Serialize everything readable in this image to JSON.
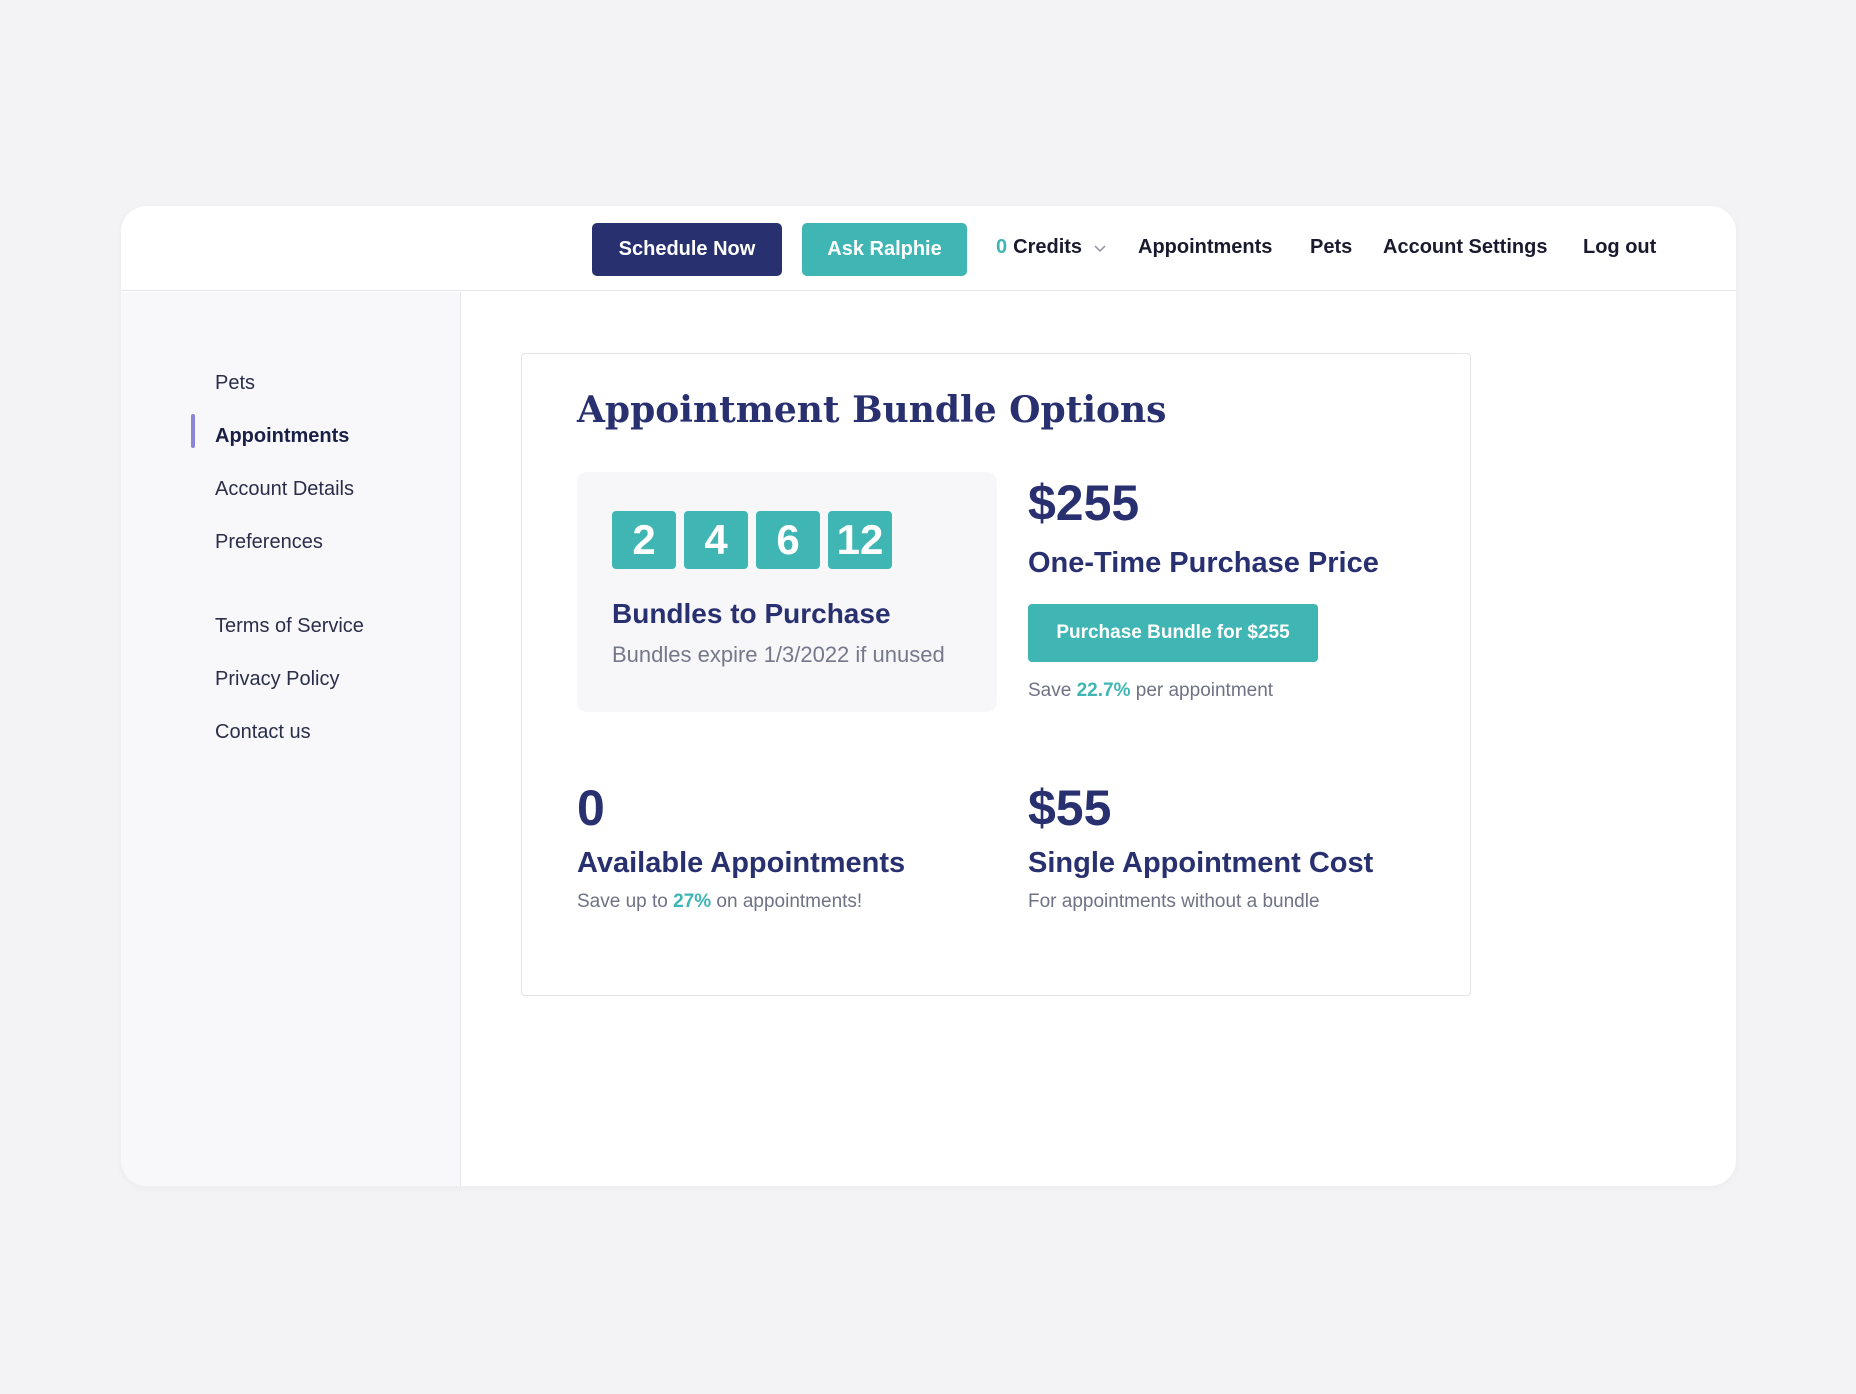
{
  "topbar": {
    "schedule_button": "Schedule Now",
    "ask_button": "Ask Ralphie",
    "credits_count": "0",
    "credits_label": "Credits",
    "nav": [
      "Appointments",
      "Pets",
      "Account Settings",
      "Log out"
    ]
  },
  "sidebar": {
    "items": [
      "Pets",
      "Appointments",
      "Account Details",
      "Preferences"
    ],
    "active_item": "Appointments",
    "footer_items": [
      "Terms of Service",
      "Privacy Policy",
      "Contact us"
    ]
  },
  "card": {
    "title": "Appointment Bundle Options",
    "bundle_options": [
      "2",
      "4",
      "6",
      "12"
    ],
    "bundles_label": "Bundles to Purchase",
    "bundles_sub": "Bundles expire 1/3/2022 if unused",
    "price": "$255",
    "price_label": "One-Time Purchase Price",
    "purchase_button": "Purchase Bundle for $255",
    "save_prefix": "Save ",
    "save_percent": "22.7%",
    "save_suffix": " per appointment",
    "available_count": "0",
    "available_label": "Available Appointments",
    "available_sub_prefix": "Save up to ",
    "available_sub_percent": "27%",
    "available_sub_suffix": " on appointments!",
    "single_cost": "$55",
    "single_label": "Single Appointment Cost",
    "single_sub": "For appointments without a bundle"
  },
  "colors": {
    "primary_navy": "#28306f",
    "accent_teal": "#3fb6b3",
    "active_indicator": "#8b84d7"
  },
  "icons": {
    "credits_dropdown": "chevron-down-icon"
  }
}
